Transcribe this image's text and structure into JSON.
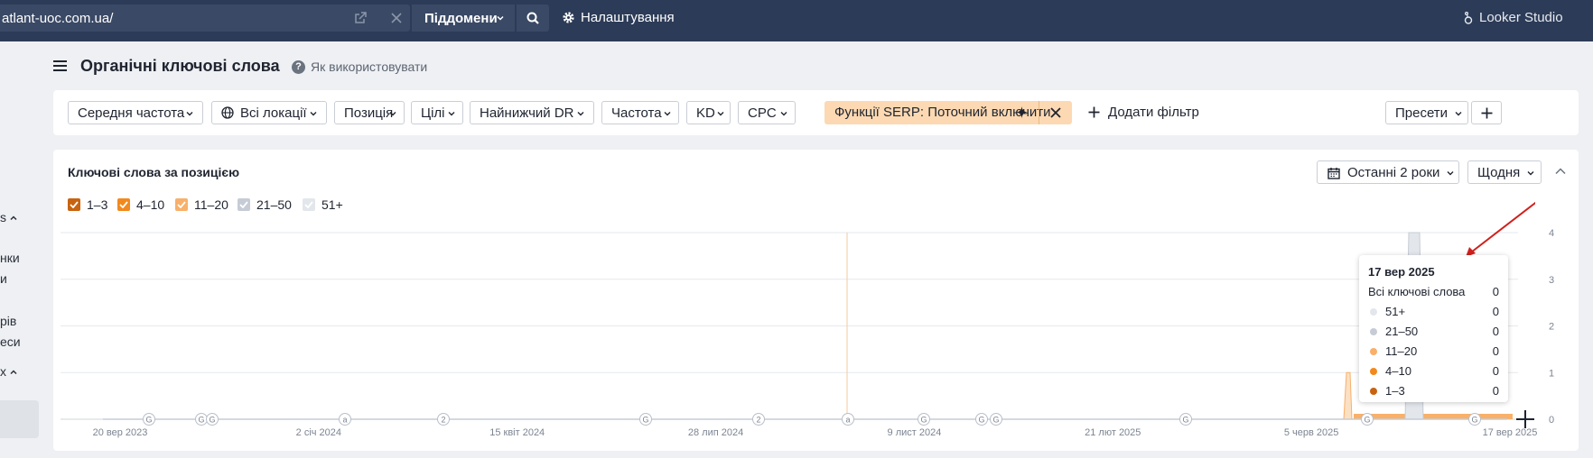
{
  "topbar": {
    "url": "atlant-uoc.com.ua/",
    "subdomains_label": "Піддомени",
    "settings_label": "Налаштування",
    "looker_label": "Looker Studio"
  },
  "sidebar": {
    "fragments": [
      "s",
      "нки",
      "и",
      "рів",
      "еси",
      "x"
    ]
  },
  "page": {
    "title": "Органічні ключові слова",
    "help_label": "Як використовувати"
  },
  "filters": {
    "chips": [
      "Середня частота",
      "Всі локації",
      "Позиція",
      "Цілі",
      "Найнижчий DR",
      "Частота",
      "KD",
      "CPC"
    ],
    "serp_label": "Функції SERP: Поточний включити",
    "add_filter_label": "Додати фільтр",
    "presets_label": "Пресети"
  },
  "panel": {
    "title": "Ключові слова за позицією",
    "range_label": "Останні 2 роки",
    "granularity_label": "Щодня",
    "legend": [
      {
        "label": "1–3",
        "color": "#c8630f",
        "checked": true
      },
      {
        "label": "4–10",
        "color": "#f2891d",
        "checked": true
      },
      {
        "label": "11–20",
        "color": "#f8b06a",
        "checked": true
      },
      {
        "label": "21–50",
        "color": "#c6ccd5",
        "checked": true
      },
      {
        "label": "51+",
        "color": "#e3e7ec",
        "checked": true
      }
    ]
  },
  "chart_data": {
    "type": "area",
    "title": "Ключові слова за позицією",
    "xlabel": "",
    "ylabel": "",
    "ylim": [
      0,
      4
    ],
    "y_ticks": [
      "4",
      "3",
      "2",
      "1",
      "0"
    ],
    "x_tick_labels": [
      "20 вер 2023",
      "2 січ 2024",
      "15 квіт 2024",
      "28 лип 2024",
      "9 лист 2024",
      "21 лют 2025",
      "5 черв 2025",
      "17 вер 2025"
    ],
    "markers": [
      "G",
      "G",
      "G",
      "a",
      "2",
      "G",
      "2",
      "a",
      "G",
      "G",
      "G",
      "G",
      "G",
      "G"
    ],
    "series": [
      {
        "name": "1–3",
        "values": [
          0,
          0,
          0,
          0,
          0,
          0,
          0,
          0
        ]
      },
      {
        "name": "4–10",
        "values": [
          0,
          0,
          0,
          0,
          0,
          0,
          0,
          0
        ]
      },
      {
        "name": "11–20",
        "values": [
          0,
          0,
          0,
          0,
          0,
          0,
          1,
          0
        ]
      },
      {
        "name": "21–50",
        "values": [
          0,
          0,
          0,
          0,
          0,
          0,
          0,
          0
        ]
      },
      {
        "name": "51+",
        "values": [
          0,
          0,
          0,
          0,
          0,
          0,
          0,
          4
        ]
      }
    ],
    "legend": "top-left",
    "grid": true
  },
  "tooltip": {
    "date": "17 вер 2025",
    "all_label": "Всі ключові слова",
    "all_value": "0",
    "rows": [
      {
        "label": "51+",
        "value": "0",
        "color": "#e3e7ec"
      },
      {
        "label": "21–50",
        "value": "0",
        "color": "#c6ccd5"
      },
      {
        "label": "11–20",
        "value": "0",
        "color": "#f8b06a"
      },
      {
        "label": "4–10",
        "value": "0",
        "color": "#f2891d"
      },
      {
        "label": "1–3",
        "value": "0",
        "color": "#c8630f"
      }
    ]
  }
}
